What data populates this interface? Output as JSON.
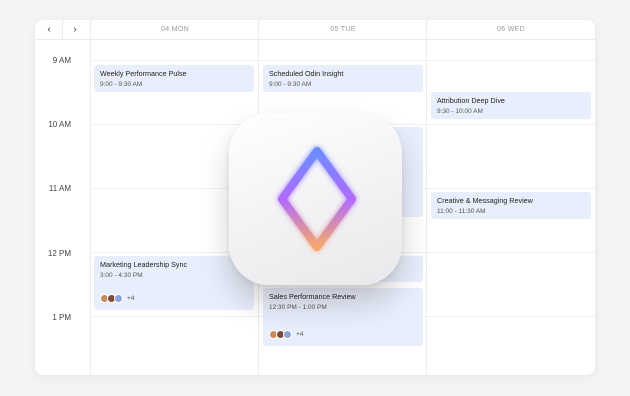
{
  "nav": {
    "prev_label": "‹",
    "next_label": "›"
  },
  "days": [
    {
      "label": "04 MON"
    },
    {
      "label": "05 TUE"
    },
    {
      "label": "06 WED"
    }
  ],
  "times": [
    "9 AM",
    "10 AM",
    "11 AM",
    "12 PM",
    "1 PM"
  ],
  "events": {
    "weekly_pulse": {
      "title": "Weekly Performance Pulse",
      "time": "9:00 - 9:30 AM"
    },
    "odin_insight": {
      "title": "Scheduled Odin Insight",
      "time": "9:00 - 9:30 AM"
    },
    "attribution": {
      "title": "Attribution Deep Dive",
      "time": "9:30 - 10:00 AM"
    },
    "creative": {
      "title": "Creative & Messaging Review",
      "time": "11:00 - 11:30 AM"
    },
    "marketing_sync": {
      "title": "Marketing Leadership Sync",
      "time": "3:00 - 4:30 PM",
      "more": "+4"
    },
    "sales_review": {
      "title": "Sales Performance Review",
      "time": "12:30 PM - 1:00 PM",
      "more": "+4"
    }
  },
  "colors": {
    "event_bg": "#e9eefc",
    "accent_gradient": [
      "#6c8cff",
      "#b06bff",
      "#f5a86b"
    ]
  },
  "app_icon": "diamond-gradient-icon"
}
